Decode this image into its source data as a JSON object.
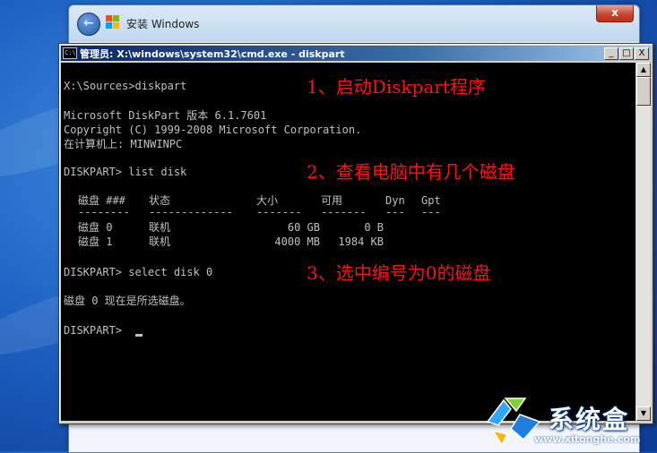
{
  "setup_window": {
    "title": "安装 Windows",
    "back_glyph": "←",
    "close_glyph": "x"
  },
  "cmd_window": {
    "title": "管理员: X:\\windows\\system32\\cmd.exe - diskpart",
    "icon_text": "C:\\",
    "buttons": {
      "minimize": "_",
      "maximize": "□",
      "close": "X"
    },
    "scroll_up": "▲",
    "scroll_down": "▼"
  },
  "console": {
    "prompt_diskpart": "X:\\Sources>diskpart",
    "version_line": "Microsoft DiskPart 版本 6.1.7601",
    "copyright_line": "Copyright (C) 1999-2008 Microsoft Corporation.",
    "computer_line": "在计算机上: MINWINPC",
    "cmd_list_disk": "DISKPART> list disk",
    "table": {
      "headers": [
        "磁盘 ###",
        "状态",
        "大小",
        "可用",
        "Dyn",
        "Gpt"
      ],
      "separators": [
        "--------",
        "-------------",
        "-------",
        "-------",
        "---",
        "---"
      ],
      "rows": [
        {
          "disk": "磁盘 0",
          "status": "联机",
          "size": "60 GB",
          "free": "0 B"
        },
        {
          "disk": "磁盘 1",
          "status": "联机",
          "size": "4000 MB",
          "free": "1984 KB"
        }
      ]
    },
    "cmd_select_disk": "DISKPART> select disk 0",
    "selected_msg": "磁盘 0 现在是所选磁盘。",
    "final_prompt": "DISKPART> "
  },
  "annotations": {
    "step1": "1、启动Diskpart程序",
    "step2": "2、查看电脑中有几个磁盘",
    "step3": "3、选中编号为0的磁盘"
  },
  "watermark": {
    "text": "系统盒",
    "url": "www.xitonghe.com"
  },
  "colors": {
    "annotation": "#ff1010",
    "console_text": "#c0c0c0",
    "console_bg": "#000000",
    "cmd_title_start": "#0a246a"
  }
}
